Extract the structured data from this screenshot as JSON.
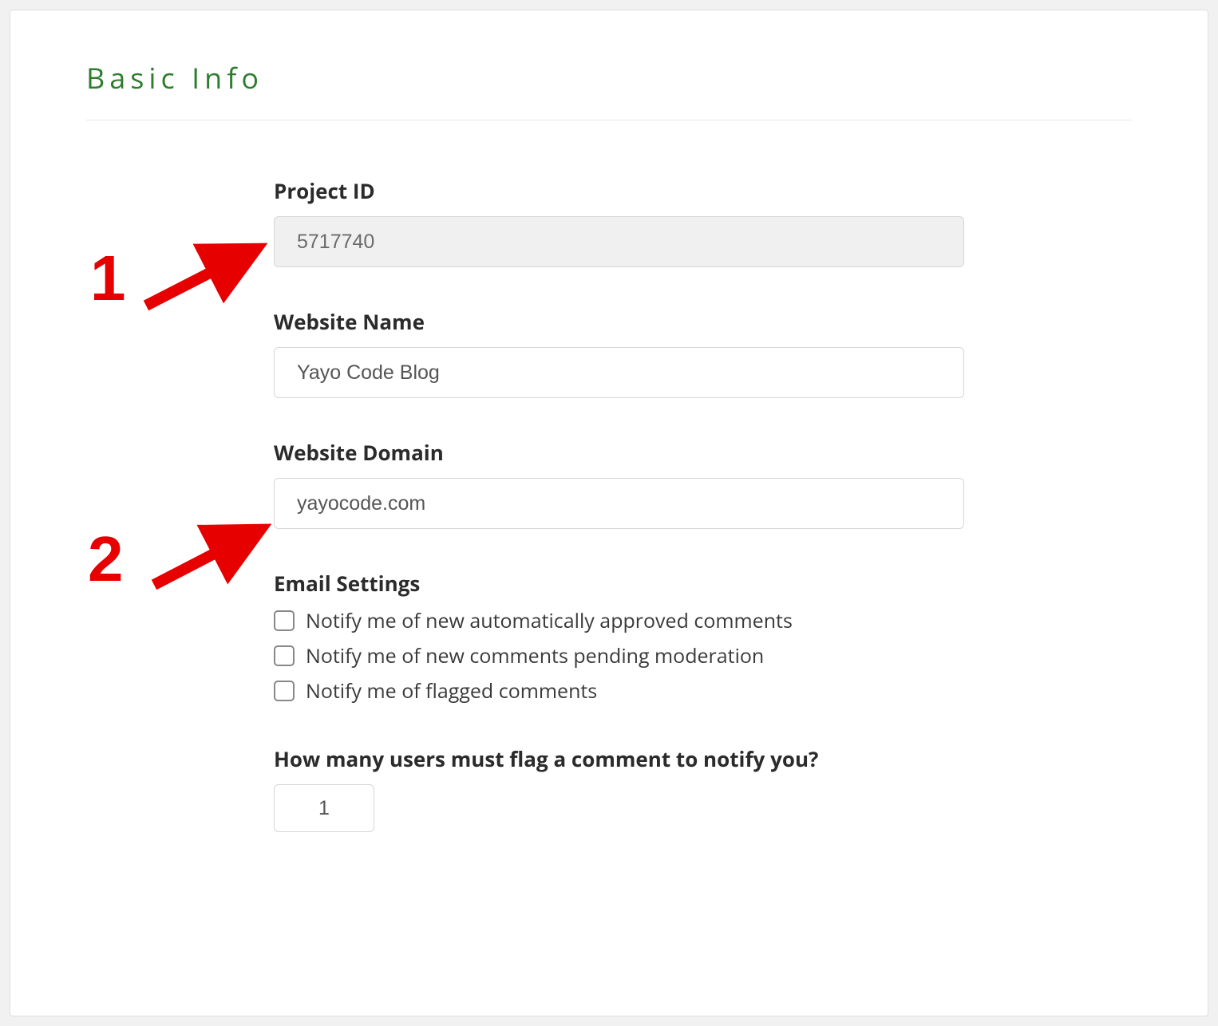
{
  "section": {
    "title": "Basic Info"
  },
  "fields": {
    "project_id": {
      "label": "Project ID",
      "value": "5717740"
    },
    "website_name": {
      "label": "Website Name",
      "value": "Yayo Code Blog"
    },
    "website_domain": {
      "label": "Website Domain",
      "value": "yayocode.com"
    },
    "email_settings": {
      "label": "Email Settings",
      "options": [
        "Notify me of new automatically approved comments",
        "Notify me of new comments pending moderation",
        "Notify me of flagged comments"
      ]
    },
    "flag_threshold": {
      "label": "How many users must flag a comment to notify you?",
      "value": "1"
    }
  },
  "annotations": {
    "one": "1",
    "two": "2"
  }
}
